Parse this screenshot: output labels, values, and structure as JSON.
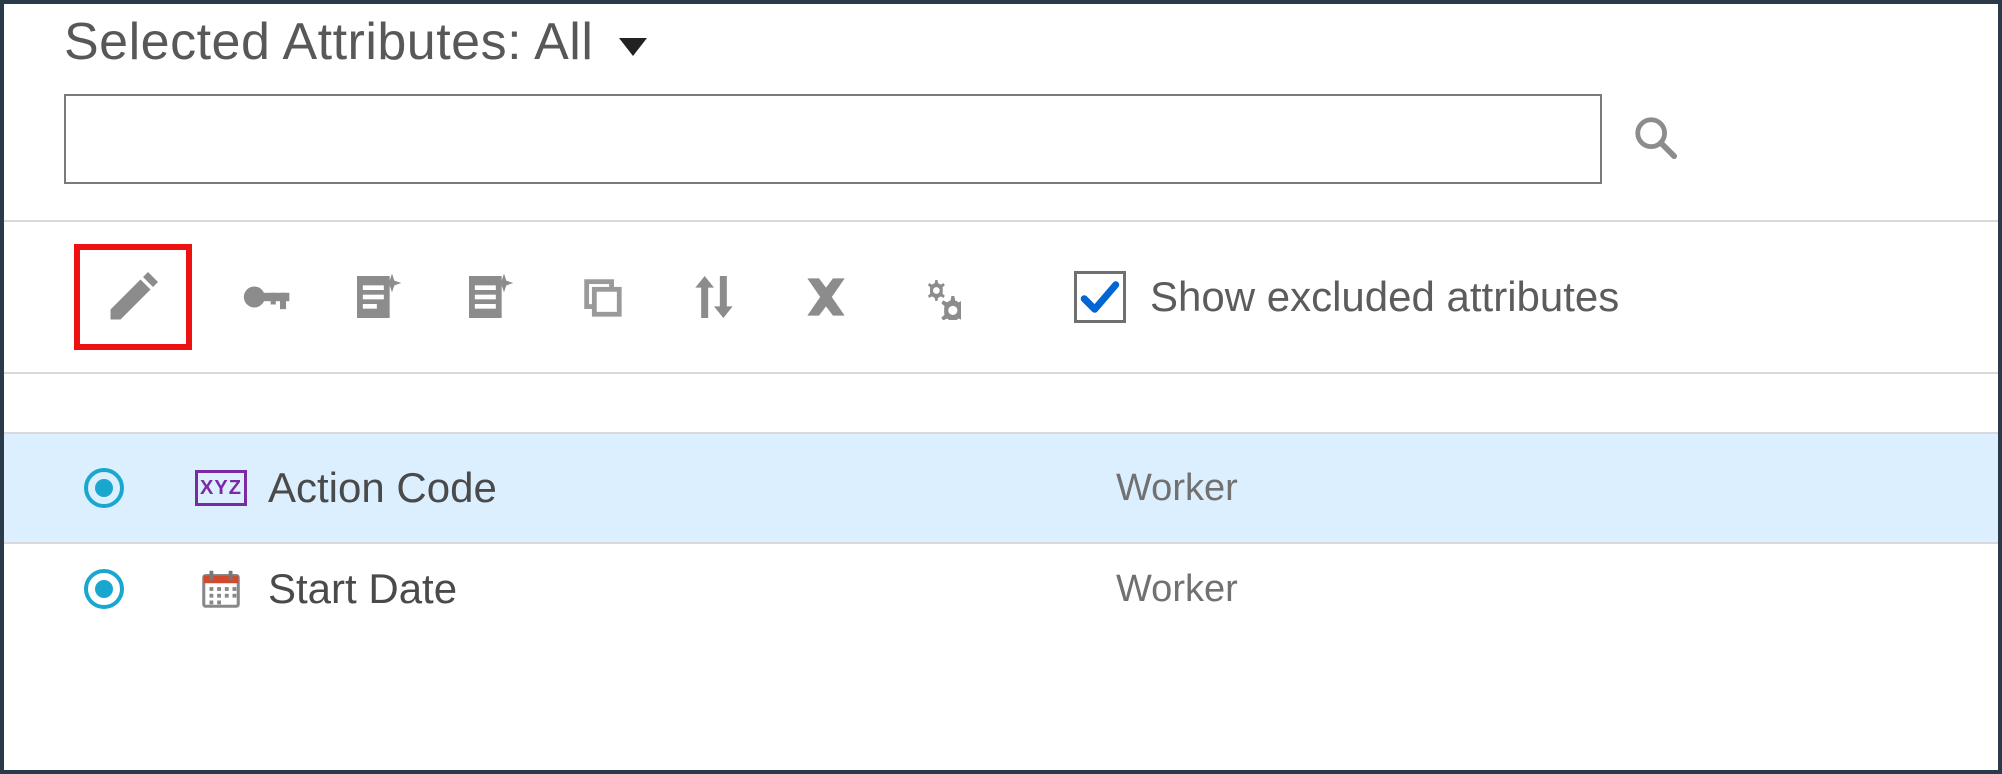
{
  "header": {
    "title": "Selected Attributes: All"
  },
  "search": {
    "value": "",
    "placeholder": ""
  },
  "toolbar": {
    "checkbox_checked": true,
    "checkbox_label": "Show excluded attributes"
  },
  "rows": [
    {
      "type_label": "XYZ",
      "name": "Action Code",
      "category": "Worker",
      "selected": true
    },
    {
      "type_label": "",
      "name": "Start Date",
      "category": "Worker",
      "selected": false
    }
  ]
}
